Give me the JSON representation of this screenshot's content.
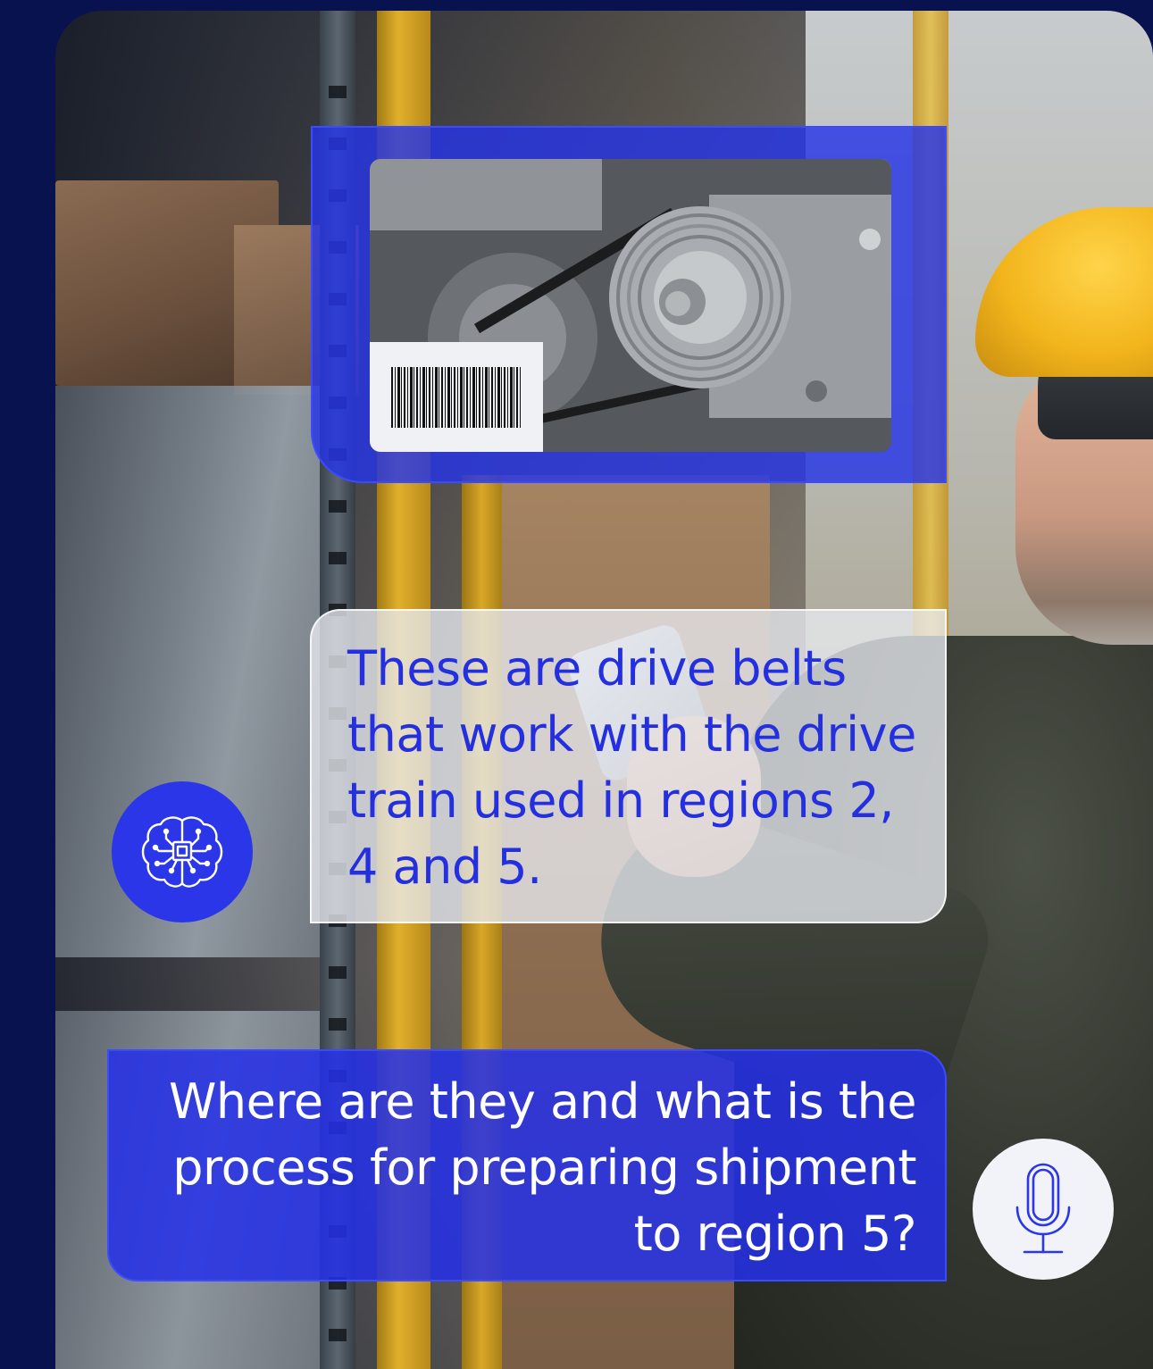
{
  "assistant": {
    "message": "These are drive belts that work with the drive train used in regions 2, 4 and 5.",
    "avatar_icon": "brain-circuit-icon"
  },
  "user": {
    "message": "Where are they and what is the process for preparing shipment to region 5?",
    "input_icon": "microphone-icon"
  },
  "scan": {
    "image_subject": "drive-belt-pulley",
    "barcode_icon": "barcode-icon"
  },
  "colors": {
    "accent": "#2a36e8",
    "page_background": "#07124f",
    "assistant_text": "#2430e0",
    "user_text": "#ffffff"
  }
}
